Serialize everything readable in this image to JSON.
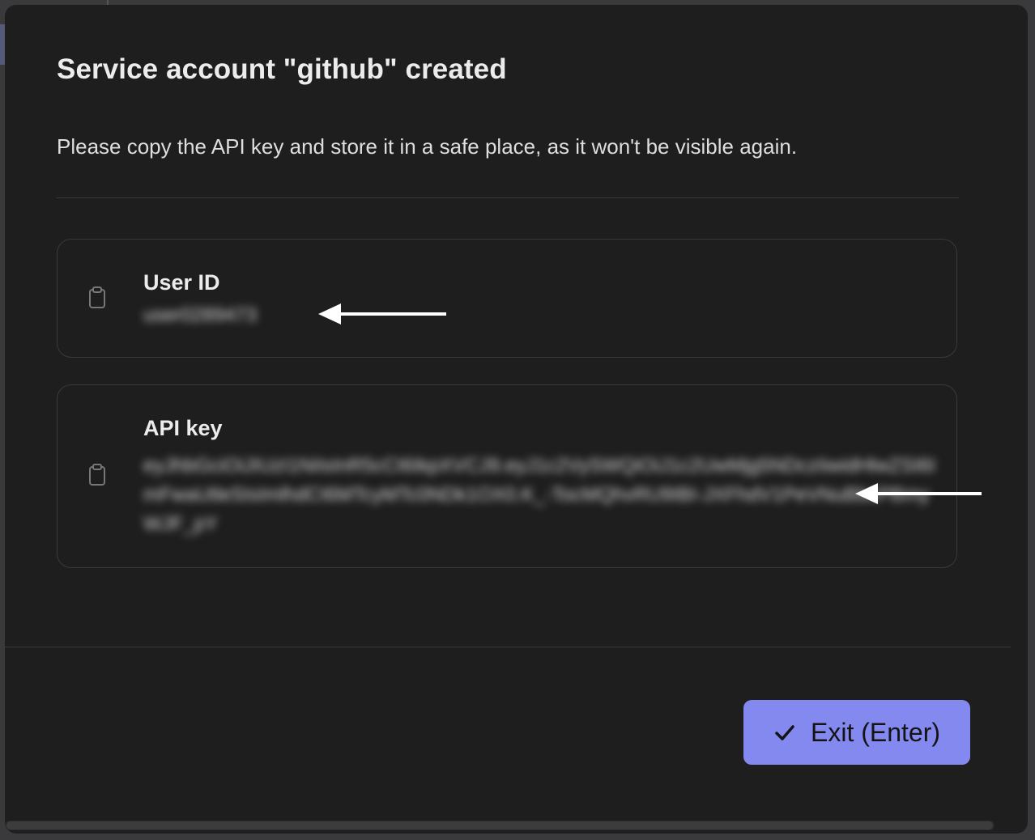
{
  "dialog": {
    "title": "Service account \"github\" created",
    "description": "Please copy the API key and store it in a safe place, as it won't be visible again."
  },
  "fields": {
    "user_id": {
      "label": "User ID",
      "value": "user0289473"
    },
    "api_key": {
      "label": "API key",
      "value": "eyJhbGciOiJIUzI1NiIsInR5cCI6IkpXVCJ9.eyJ1c2VySWQiOiJ1c2UwMjg5NDczIiwidHlwZSI6ImFwaUtleSIsImlhdCI6MTcyMTc0NDk1OX0.K_-TocMQhvRU9IBI-JXFhdV1PeVNuBbcPBmyWJF_pY"
    }
  },
  "footer": {
    "exit_label": "Exit (Enter)"
  },
  "colors": {
    "primary": "#8389ef",
    "surface": "#1e1e1e",
    "border": "#3a3a3a"
  },
  "icons": {
    "copy": "clipboard-icon",
    "confirm": "check-icon",
    "annotation": "arrow-left-icon"
  }
}
